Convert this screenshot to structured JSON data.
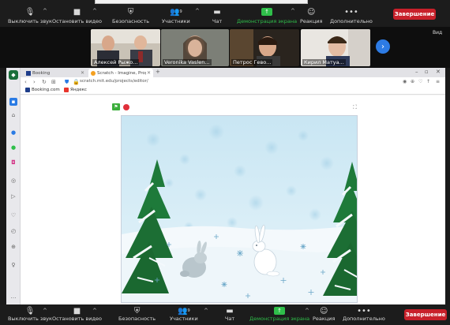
{
  "toolbar": {
    "mute": "Выключить звук",
    "stop_video": "Остановить видео",
    "security": "Безопасность",
    "participants": "Участники",
    "participants_count": "9",
    "chat": "Чат",
    "share_screen": "Демонстрация экрана",
    "reactions": "Реакция",
    "more": "Дополнительно",
    "end": "Завершение"
  },
  "participants": [
    {
      "name": "Алексей Рыжо..."
    },
    {
      "name": "Veronika Vaslen..."
    },
    {
      "name": "Петрос Гево..."
    },
    {
      "name": "Кирил Матуа..."
    }
  ],
  "view_label": "Вид",
  "browser": {
    "tabs": [
      {
        "label": "Booking"
      },
      {
        "label": "Scratch - Imagine, Program, Share"
      }
    ],
    "url": "scratch.mit.edu/projects/editor/",
    "bookmarks": [
      {
        "label": "Booking.com",
        "color": "#1e3d8a"
      },
      {
        "label": "Яндекс",
        "color": "#e8352c"
      }
    ]
  },
  "colors": {
    "end_button": "#c8202a",
    "share_green": "#2fbf4a",
    "flag_green": "#3cae3c",
    "stop_red": "#e0303a",
    "sky_blue": "#cfe7f2",
    "snow": "#f4f9fc",
    "tree_green": "#1e7a3a"
  }
}
